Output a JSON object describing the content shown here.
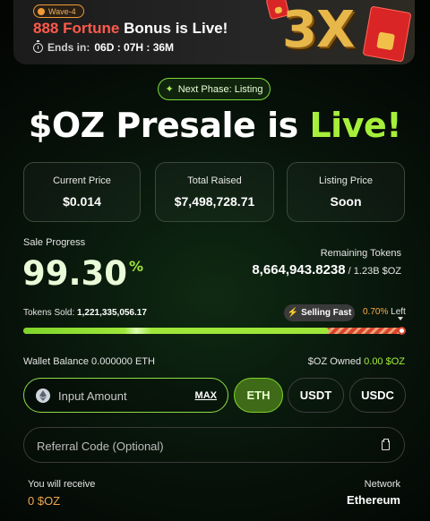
{
  "banner": {
    "wave_badge": "Wave-4",
    "title_highlight": "888 Fortune",
    "title_rest": " Bonus is Live!",
    "ends_label": "Ends in:",
    "ends_value": "06D : 07H : 36M",
    "multiplier": "3X"
  },
  "phase": {
    "label": "Next Phase: Listing"
  },
  "headline": {
    "part1": "$OZ Presale is ",
    "part2": "Live!"
  },
  "stats": {
    "current_price_label": "Current Price",
    "current_price_value": "$0.014",
    "total_raised_label": "Total Raised",
    "total_raised_value": "$7,498,728.71",
    "listing_price_label": "Listing Price",
    "listing_price_value": "Soon"
  },
  "progress": {
    "sale_label": "Sale Progress",
    "percent_value": "99.30",
    "percent_sign": "%",
    "remaining_label": "Remaining Tokens",
    "remaining_value": "8,664,943.8238",
    "remaining_total": " / 1.23B $OZ",
    "sold_label": "Tokens Sold:",
    "sold_value": "1,221,335,056.17",
    "selling_badge": "Selling Fast",
    "left_percent": "0.70%",
    "left_label": "Left",
    "fill_fraction": 0.993
  },
  "wallet": {
    "balance_label": "Wallet Balance",
    "balance_value": "0.000000 ETH",
    "owned_label": "$OZ Owned",
    "owned_value": "0.00 $OZ"
  },
  "purchase": {
    "amount_placeholder": "Input Amount",
    "max_label": "MAX",
    "currencies": [
      "ETH",
      "USDT",
      "USDC"
    ],
    "selected_currency": "ETH",
    "referral_placeholder": "Referral Code (Optional)"
  },
  "summary": {
    "receive_label": "You will receive",
    "receive_value": "0 $OZ",
    "network_label": "Network",
    "network_value": "Ethereum"
  },
  "colors": {
    "accent_green": "#a6ef3a",
    "promo_red": "#ff5a4c",
    "orange": "#f0a74a"
  }
}
